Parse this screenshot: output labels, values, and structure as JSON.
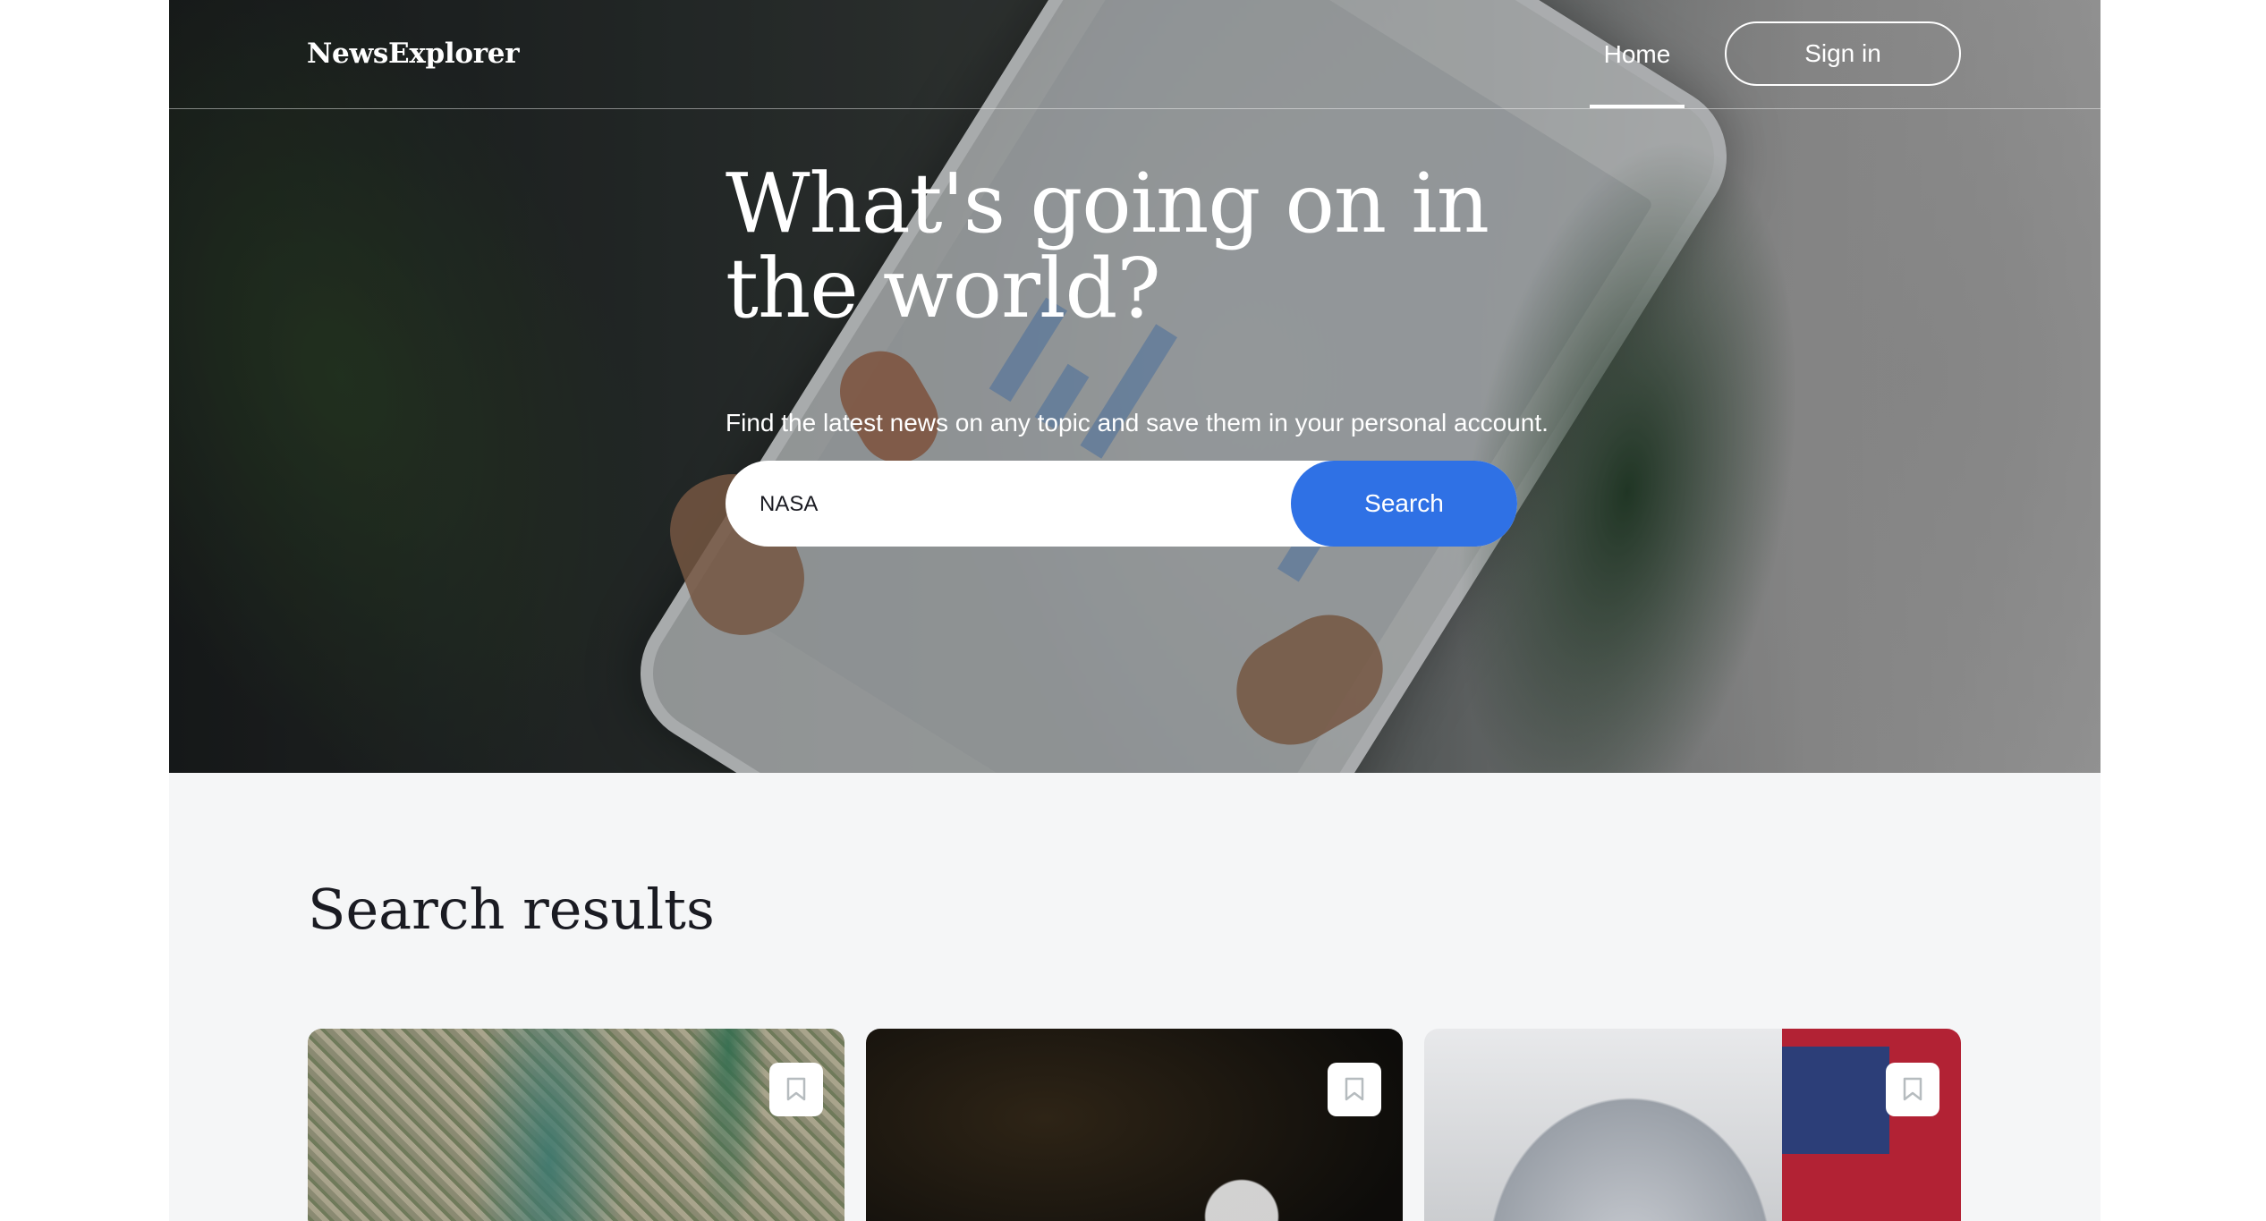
{
  "header": {
    "logo": "NewsExplorer",
    "nav": {
      "home_label": "Home",
      "signin_label": "Sign in"
    }
  },
  "hero": {
    "title": "What's going on in the world?",
    "subtitle": "Find the latest news on any topic and save them in your personal account.",
    "search": {
      "value": "NASA",
      "button_label": "Search"
    }
  },
  "results": {
    "title": "Search results",
    "cards": [
      {
        "image": "aerial-city-map-photo",
        "icon": "bookmark-icon"
      },
      {
        "image": "spacecraft-in-space-photo",
        "icon": "bookmark-icon"
      },
      {
        "image": "space-capsule-with-flag-photo",
        "icon": "bookmark-icon"
      }
    ]
  },
  "colors": {
    "accent": "#2f71e5",
    "text_dark": "#1a1b22",
    "results_bg": "#f5f6f7"
  }
}
